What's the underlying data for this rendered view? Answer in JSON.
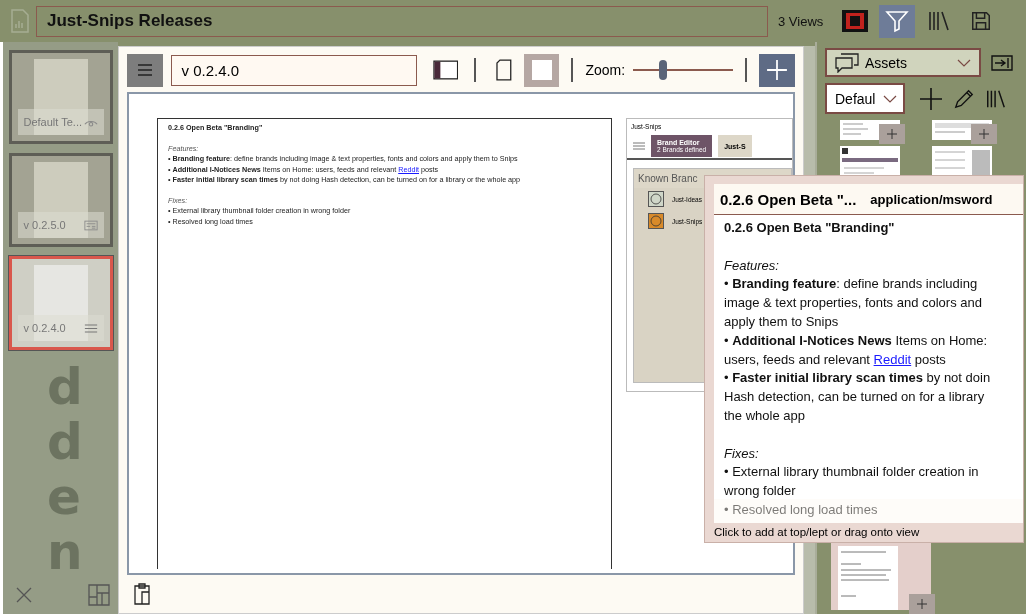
{
  "top_bar": {
    "title": "Just-Snips Releases",
    "views": "3 Views",
    "tools": [
      {
        "kind": "layout",
        "selected": false
      },
      {
        "kind": "filter",
        "selected": true
      },
      {
        "kind": "library",
        "selected": false
      },
      {
        "kind": "save",
        "selected": false
      }
    ]
  },
  "sidebar": {
    "items": [
      {
        "label": "Default Te...",
        "kind": "eye",
        "selected": false
      },
      {
        "label": "v 0.2.5.0",
        "kind": "card",
        "selected": false
      },
      {
        "label": "v 0.2.4.0",
        "kind": "menu",
        "selected": true
      }
    ],
    "group_label": "dden"
  },
  "toolbar": {
    "version": "v 0.2.4.0",
    "zoom_label": "Zoom:",
    "zoom": {
      "level": 0.3
    }
  },
  "document": {
    "lines": [
      {
        "kind": "title",
        "text": "0.2.6 Open Beta \"Branding\""
      },
      {
        "kind": "gap"
      },
      {
        "kind": "label",
        "text": "Features:"
      },
      {
        "kind": "text",
        "text": "• **Branding feature**: define brands including image & text properties, fonts and colors and apply them to Snips"
      },
      {
        "kind": "link",
        "text": "• **Additional I-Notices News** Items on Home: users, feeds and relevant ",
        "link": "Reddit",
        "after": " posts"
      },
      {
        "kind": "text",
        "text": "• **Faster initial library scan times** by not doing Hash detection, can be turned on for a library or the whole app"
      },
      {
        "kind": "gap"
      },
      {
        "kind": "label",
        "text": "Fixes:"
      },
      {
        "kind": "text",
        "text": "• External library thumbnail folder creation in wrong folder"
      },
      {
        "kind": "text",
        "text": "• Resolved long load times"
      }
    ],
    "embedded": {
      "title": "Just-Snips",
      "tabs": [
        {
          "title": "Brand Editor",
          "subtitle": "2 Brands defined",
          "selected": true
        },
        {
          "title": "Just-S",
          "selected": false
        }
      ],
      "list_header": "Known Branc",
      "brands": [
        "Just-Ideas",
        "Just-Snips"
      ]
    }
  },
  "assets": {
    "dropdown": "Assets",
    "filter": "Defaul"
  },
  "popup": {
    "title": "0.2.6 Open Beta \"...",
    "type": "application/msword",
    "lines": [
      {
        "kind": "title",
        "text": "0.2.6 Open Beta \"Branding\""
      },
      {
        "kind": "gap"
      },
      {
        "kind": "label",
        "text": "Features:"
      },
      {
        "kind": "text",
        "text": "• **Branding feature**: define brands including"
      },
      {
        "kind": "text",
        "text": "image & text properties, fonts and colors and"
      },
      {
        "kind": "text",
        "text": "apply them to Snips"
      },
      {
        "kind": "text",
        "text": "• **Additional I-Notices News** Items on Home:"
      },
      {
        "kind": "link",
        "text": "users, feeds and relevant ",
        "link": "Reddit",
        "after": " posts"
      },
      {
        "kind": "text",
        "text": "• **Faster initial library scan times** by not doin"
      },
      {
        "kind": "text",
        "text": "Hash detection, can be turned on for a library"
      },
      {
        "kind": "text",
        "text": "the whole app"
      },
      {
        "kind": "gap"
      },
      {
        "kind": "label",
        "text": "Fixes:"
      },
      {
        "kind": "text",
        "text": "• External library thumbnail folder creation in"
      },
      {
        "kind": "text",
        "text": "wrong folder"
      },
      {
        "kind": "text",
        "text": "• Resolved long load times"
      }
    ],
    "hint": "Click to add at top/lept or drag onto view"
  }
}
